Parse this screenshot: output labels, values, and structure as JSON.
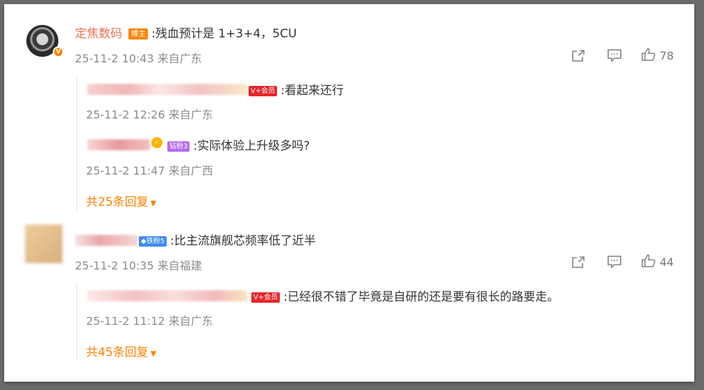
{
  "comments": [
    {
      "user": "定焦数码",
      "badge": "博主",
      "verified": "V",
      "text": ":残血预计是 1+3+4，5CU",
      "meta": "25-11-2 10:43 来自广东",
      "likes": "78",
      "replies": [
        {
          "badge": "V+会员",
          "text": ":看起来还行",
          "meta": "25-11-2 12:26 来自广东"
        },
        {
          "badge": "钻粉3",
          "text": ":实际体验上升级多吗?",
          "meta": "25-11-2 11:47 来自广西"
        }
      ],
      "more": "共25条回复"
    },
    {
      "badge": "铁粉5",
      "text": ":比主流旗舰芯频率低了近半",
      "meta": "25-11-2 10:35 来自福建",
      "likes": "44",
      "replies": [
        {
          "badge": "V+会员",
          "text": ":已经很不错了毕竟是自研的还是要有很长的路要走。",
          "meta": "25-11-2 11:12 来自广东"
        }
      ],
      "more": "共45条回复"
    }
  ],
  "icons": {
    "share": "share-icon",
    "comment": "comment-icon",
    "like": "thumbs-up-icon",
    "dropdown": "caret-down-icon"
  },
  "colors": {
    "username": "#eb7350",
    "accent": "#ff8200",
    "meta": "#8c8c8c",
    "vip": "#e6262a",
    "diamond_fan": "#b66cf0",
    "iron_fan": "#3f8cf0"
  }
}
